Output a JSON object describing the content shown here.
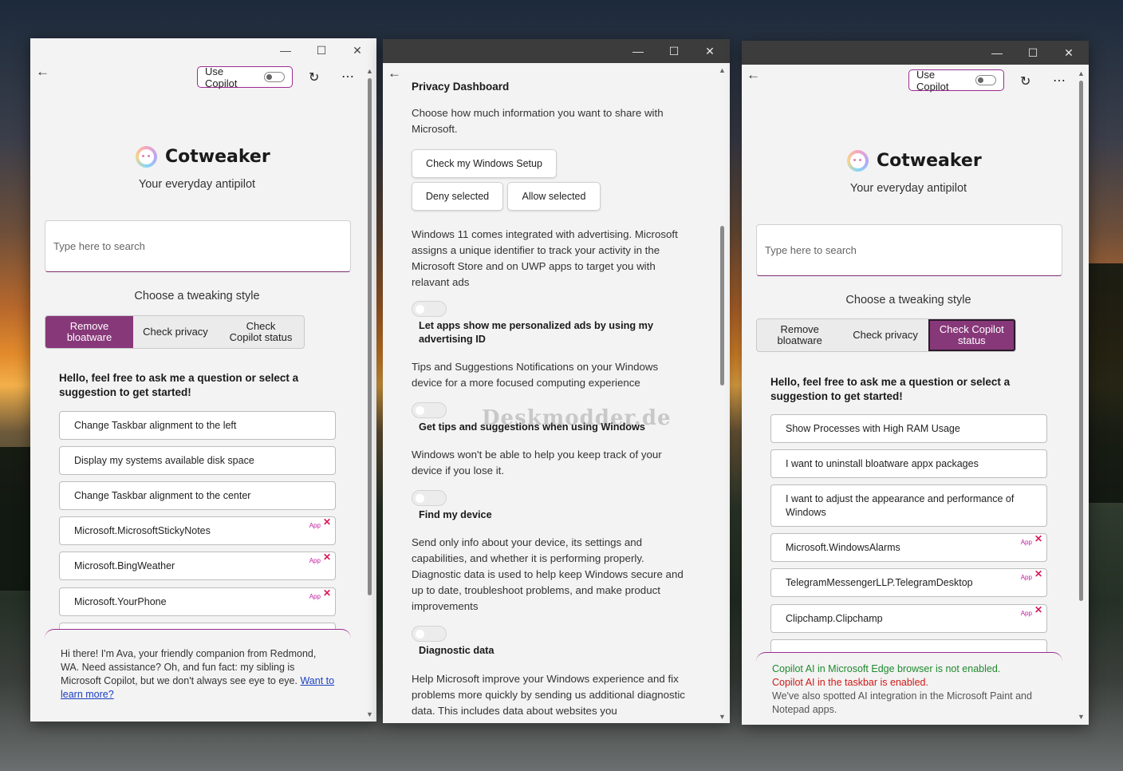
{
  "left": {
    "copilot_label": "Use Copilot",
    "brand": "Cotweaker",
    "tagline": "Your everyday antipilot",
    "search_placeholder": "Type here to search",
    "style_label": "Choose a tweaking style",
    "styles": [
      "Remove bloatware",
      "Check privacy",
      "Check Copilot status"
    ],
    "active_style": "Remove bloatware",
    "hello": "Hello, feel free to ask me a question or select a suggestion to get started!",
    "suggestions": [
      {
        "text": "Change Taskbar alignment to the left",
        "app": false
      },
      {
        "text": "Display my systems available disk space",
        "app": false
      },
      {
        "text": "Change Taskbar alignment to the center",
        "app": false
      },
      {
        "text": "Microsoft.MicrosoftStickyNotes",
        "app": true
      },
      {
        "text": "Microsoft.BingWeather",
        "app": true
      },
      {
        "text": "Microsoft.YourPhone",
        "app": true
      }
    ],
    "app_badge": "App",
    "chat_text": "Hi there! I'm Ava, your friendly companion from Redmond, WA. Need assistance? Oh, and fun fact: my sibling is Microsoft Copilot, but we don't always see eye to eye.",
    "chat_link": "Want to learn more?"
  },
  "middle": {
    "title": "Privacy Dashboard",
    "intro": "Choose how much information you want to share with Microsoft.",
    "buttons": {
      "check": "Check my Windows Setup",
      "deny": "Deny selected",
      "allow": "Allow selected"
    },
    "items": [
      {
        "desc": "Windows 11 comes integrated with advertising. Microsoft assigns a unique identifier to track your activity in the Microsoft Store and on UWP apps to target you with relavant ads",
        "label": "Let apps show me personalized ads by using my advertising ID"
      },
      {
        "desc": "Tips and Suggestions Notifications on your Windows device for a more focused computing experience",
        "label": "Get tips and suggestions when using Windows"
      },
      {
        "desc": "Windows won't be able to help you keep track of your device if you lose it.",
        "label": "Find my device"
      },
      {
        "desc": "Send only info about your device, its settings and capabilities, and whether it is performing properly. Diagnostic data is used to help keep Windows secure and up to date, troubleshoot problems, and make product improvements",
        "label": "Diagnostic data"
      },
      {
        "desc": "Help Microsoft improve your Windows experience and fix problems more quickly by sending us additional diagnostic data. This includes data about websites you",
        "label": ""
      }
    ],
    "watermark": "Deskmodder.de"
  },
  "right": {
    "copilot_label": "Use Copilot",
    "brand": "Cotweaker",
    "tagline": "Your everyday antipilot",
    "search_placeholder": "Type here to search",
    "style_label": "Choose a tweaking style",
    "styles": [
      "Remove bloatware",
      "Check privacy",
      "Check Copilot status"
    ],
    "active_style": "Check Copilot status",
    "hello": "Hello, feel free to ask me a question or select a suggestion to get started!",
    "suggestions": [
      {
        "text": "Show Processes with High RAM Usage",
        "app": false
      },
      {
        "text": "I want to uninstall bloatware appx packages",
        "app": false
      },
      {
        "text": "I want to adjust the appearance and performance of Windows",
        "app": false
      },
      {
        "text": "Microsoft.WindowsAlarms",
        "app": true
      },
      {
        "text": "TelegramMessengerLLP.TelegramDesktop",
        "app": true
      },
      {
        "text": "Clipchamp.Clipchamp",
        "app": true
      }
    ],
    "app_badge": "App",
    "status": [
      {
        "text": "Copilot AI in Microsoft Edge browser is not enabled.",
        "kind": "ok"
      },
      {
        "text": "Copilot AI in the taskbar is enabled.",
        "kind": "bad"
      },
      {
        "text": "We've also spotted AI integration in the Microsoft Paint and Notepad apps.",
        "kind": "neutral"
      }
    ]
  },
  "icons": {
    "back": "arrow-left-icon",
    "refresh": "refresh-icon",
    "more": "more-icon",
    "minimize": "minimize-icon",
    "maximize": "maximize-icon",
    "close": "close-icon"
  }
}
